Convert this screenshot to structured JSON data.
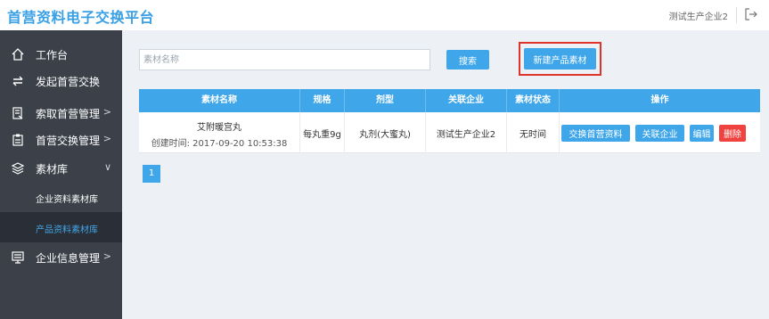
{
  "app": {
    "title": "首营资料电子交换平台",
    "user": "测试生产企业2"
  },
  "sidebar": {
    "items": [
      {
        "label": "工作台",
        "icon": "home-icon"
      },
      {
        "label": "发起首营交换",
        "icon": "exchange-icon"
      },
      {
        "label": "索取首营管理",
        "icon": "request-icon",
        "chevron": ">"
      },
      {
        "label": "首营交换管理",
        "icon": "clipboard-icon",
        "chevron": ">"
      },
      {
        "label": "素材库",
        "icon": "layers-icon",
        "chevron": "∨"
      },
      {
        "label": "企业信息管理",
        "icon": "building-icon",
        "chevron": ">"
      }
    ],
    "subitems": [
      {
        "label": "企业资料素材库"
      },
      {
        "label": "产品资料素材库",
        "active": true
      }
    ]
  },
  "search": {
    "placeholder": "素材名称",
    "button": "搜索",
    "new_button": "新建产品素材"
  },
  "table": {
    "headers": [
      "素材名称",
      "规格",
      "剂型",
      "关联企业",
      "素材状态",
      "操作"
    ],
    "rows": [
      {
        "name": "艾附暖宫丸",
        "created": "创建时间: 2017-09-20 10:53:38",
        "spec": "每丸重9g",
        "form": "丸剂(大蜜丸)",
        "company": "测试生产企业2",
        "status": "无时间",
        "actions": [
          "交换首营资料",
          "关联企业",
          "编辑",
          "删除"
        ]
      }
    ]
  },
  "pagination": {
    "current": "1"
  },
  "colors": {
    "accent": "#3fa6ea",
    "sidebar": "#3b4049",
    "danger": "#f0433f",
    "highlight": "#e0342b"
  }
}
